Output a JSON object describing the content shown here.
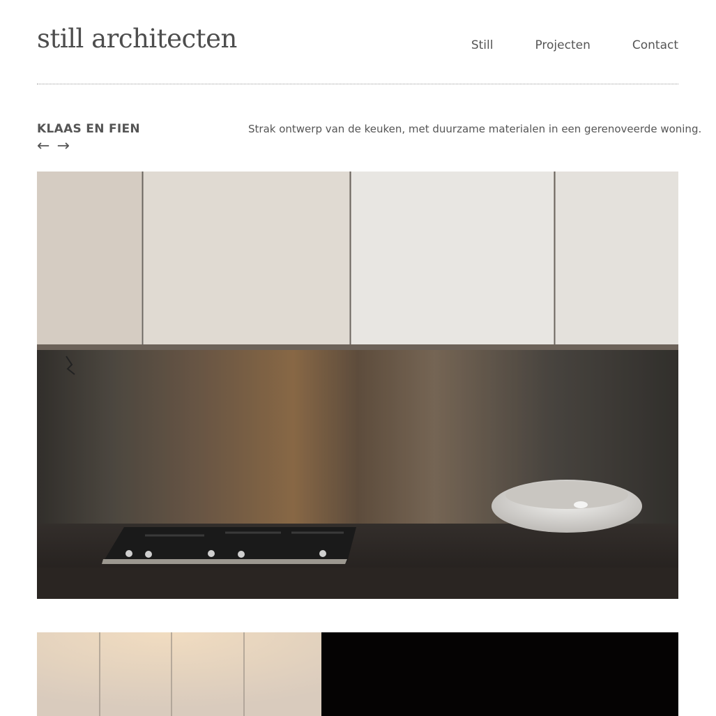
{
  "header": {
    "logo": "still architecten",
    "nav": [
      "Still",
      "Projecten",
      "Contact"
    ]
  },
  "project": {
    "title": "KLAAS EN FIEN",
    "prev_arrow": "←",
    "next_arrow": "→",
    "description": "Strak ontwerp van de keuken, met duurzame materialen in een gerenoveerde woning."
  },
  "colors": {
    "text": "#4a4a4a",
    "background": "#ffffff"
  }
}
